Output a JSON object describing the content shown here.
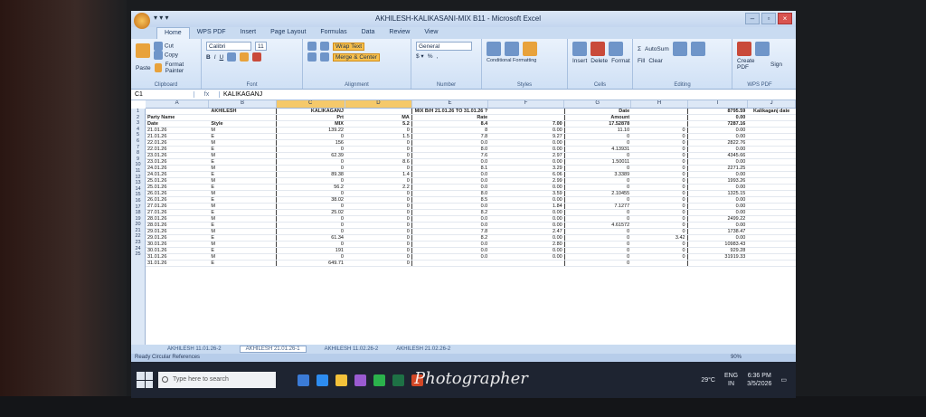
{
  "window": {
    "title": "AKHILESH-KALIKASANI-MIX B11 - Microsoft Excel"
  },
  "qat": {
    "label": "▾ ▾ ▾"
  },
  "ribbon_tabs": [
    "Home",
    "WPS PDF",
    "Insert",
    "Page Layout",
    "Formulas",
    "Data",
    "Review",
    "View"
  ],
  "ribbon": {
    "cut": "Cut",
    "copy": "Copy",
    "format_painter": "Format Painter",
    "paste": "Paste",
    "clipboard": "Clipboard",
    "font_name": "Calibri",
    "font_size": "11",
    "font": "Font",
    "wrap_text": "Wrap Text",
    "merge_center": "Merge & Center",
    "alignment": "Alignment",
    "number_format": "General",
    "number": "Number",
    "conditional_formatting": "Conditional Formatting",
    "format_as_table": "Format as Table",
    "cell_styles": "Cell Styles",
    "styles": "Styles",
    "insert": "Insert",
    "delete": "Delete",
    "format": "Format",
    "cells": "Cells",
    "autosum": "AutoSum",
    "fill": "Fill",
    "clear": "Clear",
    "sort_filter": "Sort & Filter",
    "find_select": "Find & Select",
    "editing": "Editing",
    "create_pdf": "Create PDF",
    "sign": "Sign",
    "wps_pdf": "WPS PDF"
  },
  "formula_bar": {
    "name_box": "C1",
    "fx": "fx",
    "value": "KALIKAGANJ"
  },
  "columns": [
    "A",
    "B",
    "C",
    "D",
    "E",
    "F",
    "G",
    "H",
    "I",
    "J"
  ],
  "sheet": {
    "header1": [
      "",
      "AKHILESH",
      "KALIKAGANJ",
      "",
      "MIX B/H 21.01.26 TO 31.01.26 ?",
      "",
      "Date",
      "",
      "8795.59",
      "Kalikaganj date"
    ],
    "header2": [
      "Party Name",
      "",
      "Prt",
      "MA",
      "Rate",
      "",
      "Amount",
      "",
      "0.00",
      ""
    ],
    "header3": [
      "Date",
      "Style",
      "MIX",
      "5.2",
      "8.4",
      "7.00",
      "17.52878",
      "",
      "7287.16",
      ""
    ],
    "rows": [
      [
        "21.01.26",
        "M",
        "139.22",
        "0",
        "8",
        "0.00",
        "11.10",
        "0",
        "0.00",
        ""
      ],
      [
        "21.01.26",
        "E",
        "0",
        "1.5",
        "7.8",
        "9.27",
        "0",
        "0",
        "0.00",
        ""
      ],
      [
        "22.01.26",
        "M",
        "156",
        "0",
        "0.0",
        "0.00",
        "0",
        "0",
        "2822.76",
        ""
      ],
      [
        "22.01.26",
        "E",
        "0",
        "0",
        "8.0",
        "0.00",
        "4.13931",
        "0",
        "0.00",
        ""
      ],
      [
        "23.01.26",
        "M",
        "62.39",
        "0",
        "7.6",
        "2.97",
        "0",
        "0",
        "4345.66",
        ""
      ],
      [
        "23.01.26",
        "E",
        "0",
        "8.6",
        "0.0",
        "0.00",
        "1.50011",
        "0",
        "0.00",
        ""
      ],
      [
        "24.01.26",
        "M",
        "0",
        "0",
        "8.1",
        "3.29",
        "0",
        "0",
        "2271.25",
        ""
      ],
      [
        "24.01.26",
        "E",
        "89.38",
        "1.4",
        "0.0",
        "6.06",
        "3.3389",
        "0",
        "0.00",
        ""
      ],
      [
        "25.01.26",
        "M",
        "0",
        "0",
        "0.0",
        "2.99",
        "0",
        "0",
        "1993.26",
        ""
      ],
      [
        "25.01.26",
        "E",
        "56.2",
        "2.2",
        "0.0",
        "0.00",
        "0",
        "0",
        "0.00",
        ""
      ],
      [
        "26.01.26",
        "M",
        "0",
        "0",
        "8.0",
        "3.59",
        "2.10455",
        "0",
        "1325.15",
        ""
      ],
      [
        "26.01.26",
        "E",
        "38.02",
        "0",
        "8.5",
        "0.00",
        "0",
        "0",
        "0.00",
        ""
      ],
      [
        "27.01.26",
        "M",
        "0",
        "0",
        "0.0",
        "1.84",
        "7.1277",
        "0",
        "0.00",
        ""
      ],
      [
        "27.01.26",
        "E",
        "25.02",
        "0",
        "8.2",
        "0.00",
        "0",
        "0",
        "0.00",
        ""
      ],
      [
        "28.01.26",
        "M",
        "0",
        "0",
        "0.0",
        "0.00",
        "0",
        "0",
        "2499.22",
        ""
      ],
      [
        "28.01.26",
        "E",
        "0",
        "0",
        "0.0",
        "0.00",
        "4.61572",
        "0",
        "0.00",
        ""
      ],
      [
        "29.01.26",
        "M",
        "0",
        "0",
        "7.8",
        "2.47",
        "0",
        "0",
        "1738.47",
        ""
      ],
      [
        "29.01.26",
        "E",
        "61.34",
        "0",
        "8.2",
        "0.00",
        "0",
        "3.42",
        "0.00",
        ""
      ],
      [
        "30.01.26",
        "M",
        "0",
        "0",
        "0.0",
        "2.80",
        "0",
        "0",
        "10983.43",
        ""
      ],
      [
        "30.01.26",
        "E",
        "191",
        "0",
        "0.0",
        "0.00",
        "0",
        "0",
        "929.28",
        ""
      ],
      [
        "31.01.26",
        "M",
        "0",
        "0",
        "0.0",
        "0.00",
        "0",
        "0",
        "31919.33",
        ""
      ],
      [
        "31.01.26",
        "E",
        "649.71",
        "0",
        "",
        "",
        "0",
        "",
        "",
        ""
      ]
    ]
  },
  "sheet_tabs": [
    "AKHILESH 11.01.26-2",
    "AKHILESH 21.01.26-1",
    "AKHILESH 11.02.26-2",
    "AKHILESH 21.02.26-2"
  ],
  "status": {
    "ready": "Ready",
    "macro": "Circular References",
    "zoom": "90%"
  },
  "taskbar": {
    "search_placeholder": "Type here to search",
    "weather": "29°C",
    "lang": "ENG",
    "lang2": "IN",
    "time": "6:36 PM",
    "date": "3/5/2026"
  },
  "watermark": "Photographer",
  "colors": {
    "excel_accent": "#1f4e8c",
    "ribbon": "#dbe7f6",
    "taskbar": "#1e2431"
  }
}
